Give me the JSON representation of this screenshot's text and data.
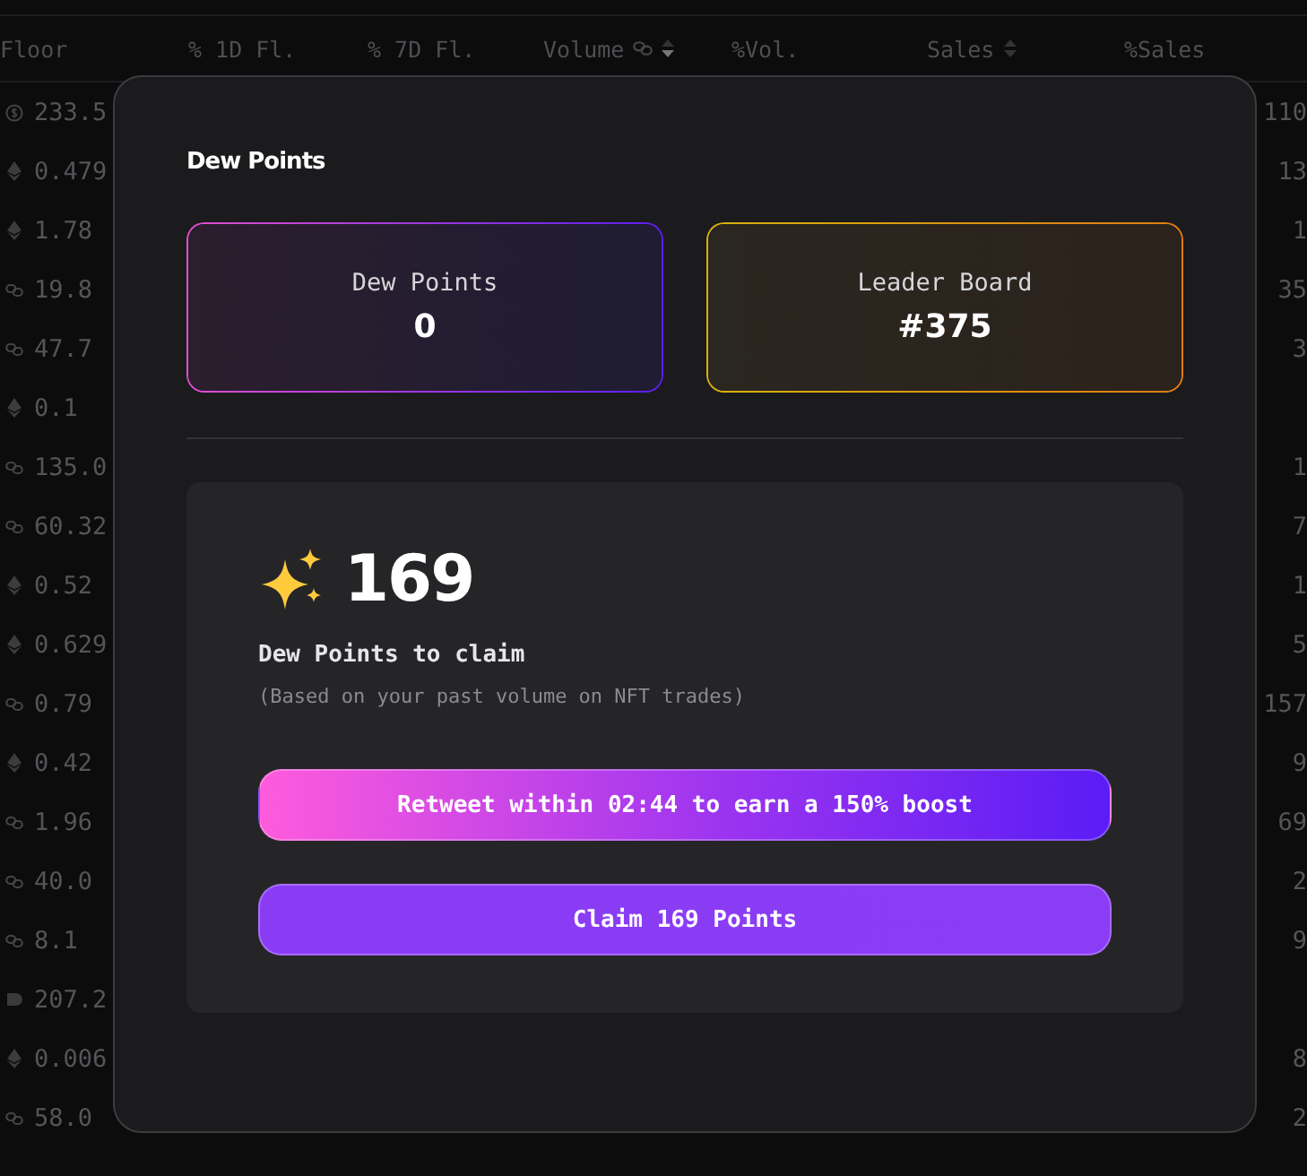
{
  "table": {
    "columns": [
      {
        "label": "Floor",
        "sortable": false
      },
      {
        "label": "% 1D Fl.",
        "sortable": false
      },
      {
        "label": "% 7D Fl.",
        "sortable": false
      },
      {
        "label": "Volume",
        "sortable": true,
        "sorted": true,
        "currency_icon": true
      },
      {
        "label": "%Vol.",
        "sortable": false
      },
      {
        "label": "Sales",
        "sortable": true,
        "sorted": false
      },
      {
        "label": "%Sales",
        "sortable": false
      }
    ],
    "rows": [
      {
        "kind": "usd",
        "floor": "233.5",
        "sales_pct": "110"
      },
      {
        "kind": "eth",
        "floor": "0.479",
        "sales_pct": "13"
      },
      {
        "kind": "eth",
        "floor": "1.78",
        "sales_pct": "1"
      },
      {
        "kind": "link",
        "floor": "19.8",
        "sales_pct": "35"
      },
      {
        "kind": "link",
        "floor": "47.7",
        "sales_pct": "3"
      },
      {
        "kind": "eth",
        "floor": "0.1"
      },
      {
        "kind": "link",
        "floor": "135.0",
        "sales_pct": "1"
      },
      {
        "kind": "link",
        "floor": "60.32",
        "sales_pct": "7"
      },
      {
        "kind": "eth",
        "floor": "0.52",
        "sales_pct": "1"
      },
      {
        "kind": "eth",
        "floor": "0.629",
        "sales_pct": "5"
      },
      {
        "kind": "link",
        "floor": "0.79",
        "sales_pct": "157"
      },
      {
        "kind": "eth",
        "floor": "0.42",
        "sales_pct": "9"
      },
      {
        "kind": "link",
        "floor": "1.96",
        "sales_pct": "69"
      },
      {
        "kind": "link",
        "floor": "40.0",
        "sales_pct": "2"
      },
      {
        "kind": "link",
        "floor": "8.1",
        "sales_pct": "9"
      },
      {
        "kind": "token",
        "floor": "207.2"
      },
      {
        "kind": "eth",
        "floor": "0.006",
        "sales_pct": "8"
      },
      {
        "kind": "link",
        "floor": "58.0",
        "sales_pct": "2"
      }
    ]
  },
  "modal": {
    "title": "Dew Points",
    "stats": [
      {
        "label": "Dew Points",
        "value": "0",
        "kind": "points"
      },
      {
        "label": "Leader Board",
        "value": "#375",
        "kind": "rank"
      }
    ],
    "claim": {
      "amount": "169",
      "label": "Dew Points to claim",
      "note": "(Based on your past volume on NFT trades)",
      "buttons": [
        {
          "label": "Retweet within 02:44 to earn a 150% boost",
          "kind": "boost"
        },
        {
          "label": "Claim 169 Points",
          "kind": "claim"
        }
      ]
    }
  }
}
